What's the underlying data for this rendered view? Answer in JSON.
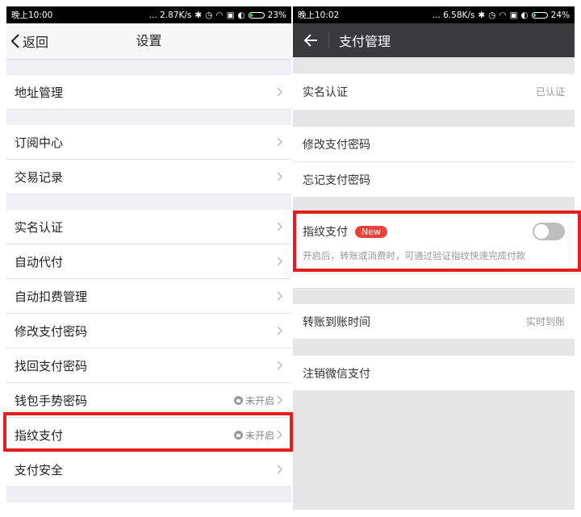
{
  "left": {
    "status_bar": {
      "time": "晚上10:00",
      "speed": "... 2.87K/s",
      "icons": [
        "bluetooth-icon",
        "alarm-icon",
        "wifi-icon",
        "sim-icon",
        "signal-icon"
      ],
      "battery": "23%",
      "battery_level": 0.23
    },
    "header": {
      "back_label": "返回",
      "title": "设置"
    },
    "groups": [
      [
        {
          "label": "地址管理"
        }
      ],
      [
        {
          "label": "订阅中心"
        },
        {
          "label": "交易记录"
        }
      ],
      [
        {
          "label": "实名认证"
        },
        {
          "label": "自动代付"
        },
        {
          "label": "自动扣费管理"
        },
        {
          "label": "修改支付密码"
        },
        {
          "label": "找回支付密码"
        },
        {
          "label": "钱包手势密码",
          "status": "未开启"
        },
        {
          "label": "指纹支付",
          "status": "未开启",
          "highlighted": true
        },
        {
          "label": "支付安全"
        }
      ]
    ]
  },
  "right": {
    "status_bar": {
      "time": "晚上10:02",
      "speed": "... 6.58K/s",
      "icons": [
        "bluetooth-icon",
        "alarm-icon",
        "wifi-icon",
        "sim-icon",
        "signal-icon"
      ],
      "battery": "24%",
      "battery_level": 0.24
    },
    "header": {
      "title": "支付管理"
    },
    "verify": {
      "label": "实名认证",
      "value": "已认证"
    },
    "password": [
      {
        "label": "修改支付密码"
      },
      {
        "label": "忘记支付密码"
      }
    ],
    "fingerprint": {
      "label": "指纹支付",
      "badge": "New",
      "enabled": false,
      "description": "开启后，转账或消费时，可通过验证指纹快速完成付款"
    },
    "transfer": {
      "label": "转账到账时间",
      "value": "实时到账"
    },
    "cancel": {
      "label": "注销微信支付"
    }
  },
  "colors": {
    "highlight": "#e41e1e",
    "badge": "#e8423b",
    "dark_header": "#3a3a3c"
  }
}
